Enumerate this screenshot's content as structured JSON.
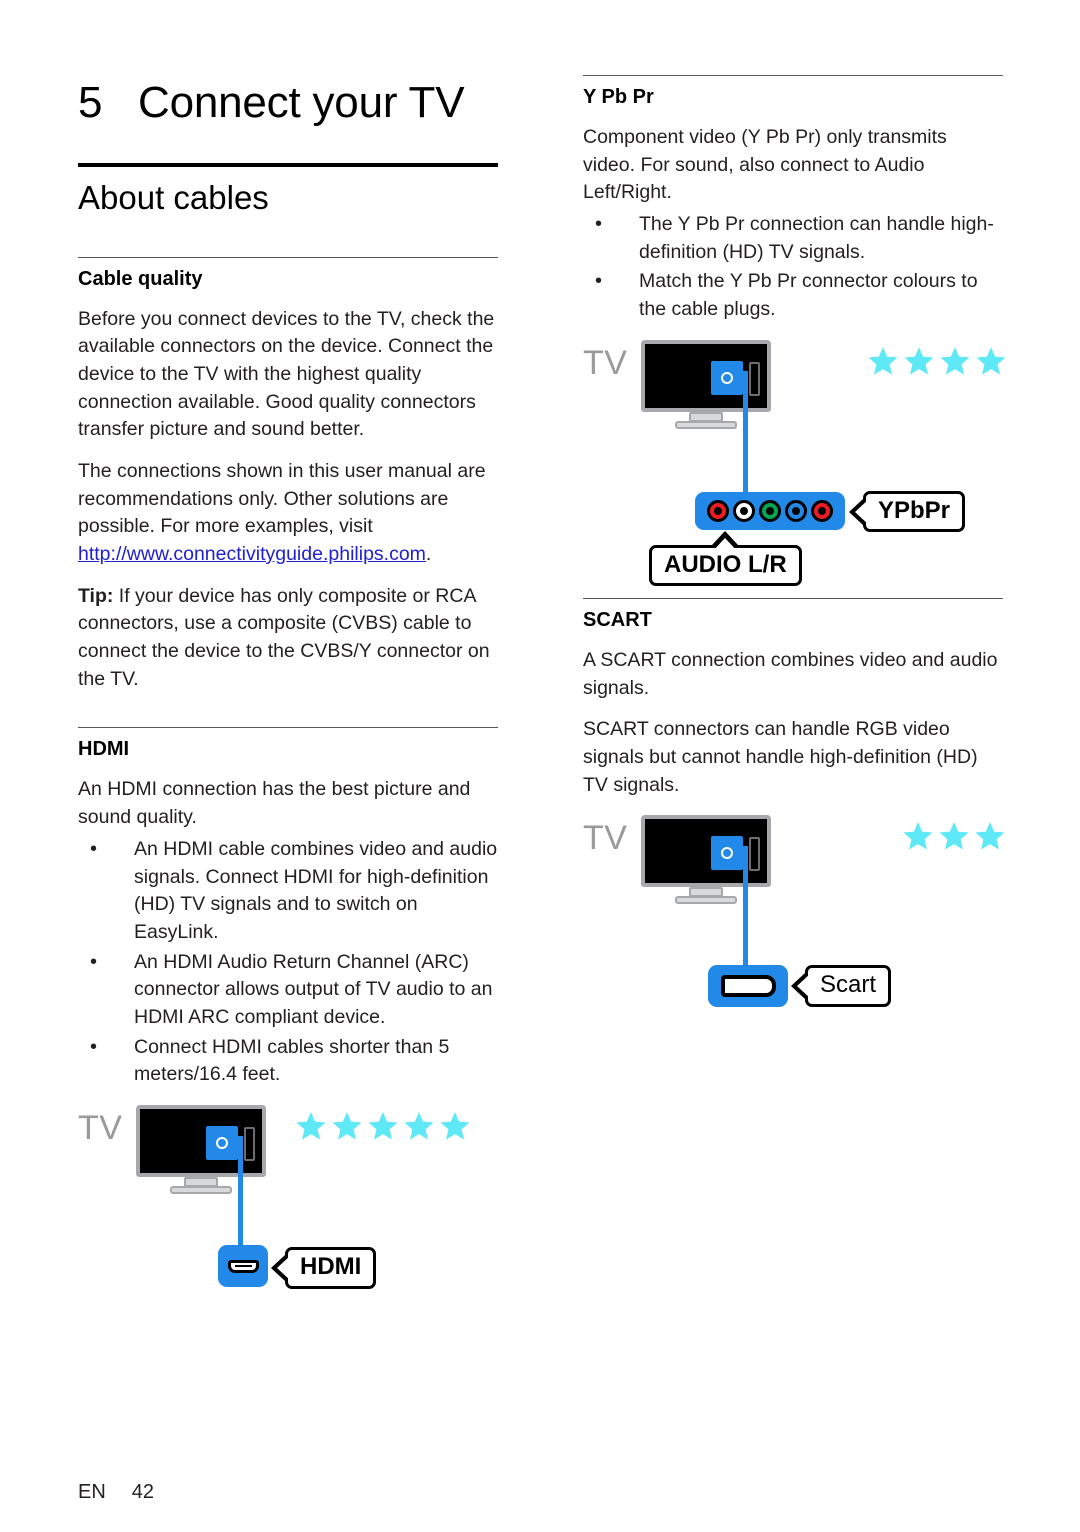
{
  "document": {
    "chapter_number": "5",
    "chapter_title": "Connect your TV",
    "footer": {
      "language": "EN",
      "page_number": "42"
    }
  },
  "left_column": {
    "section_heading": "About cables",
    "cable_quality": {
      "heading": "Cable quality",
      "paragraph_1": "Before you connect devices to the TV, check the available connectors on the device. Connect the device to the TV with the highest quality connection available. Good quality connectors transfer picture and sound better.",
      "paragraph_2_before_link": "The connections shown in this user manual are recommendations only. Other solutions are possible. For more examples, visit ",
      "link_text": "http://www.connectivityguide.philips.com",
      "paragraph_2_after_link": ".",
      "tip_label": "Tip:",
      "tip_text": " If your device has only composite or RCA connectors, use a composite (CVBS) cable to connect the device to the CVBS/Y connector on the TV."
    },
    "hdmi": {
      "heading": "HDMI",
      "intro": "An HDMI connection has the best picture and sound quality.",
      "bullets": [
        "An HDMI cable combines video and audio signals. Connect HDMI for high-definition (HD) TV signals and to switch on EasyLink.",
        "An HDMI Audio Return Channel (ARC) connector allows output of TV audio to an HDMI ARC compliant device.",
        "Connect HDMI cables shorter than 5 meters/16.4 feet."
      ],
      "figure": {
        "tv_label": "TV",
        "connector_label": "HDMI",
        "star_rating": 5
      }
    }
  },
  "right_column": {
    "ypbpr": {
      "heading": "Y Pb Pr",
      "intro": "Component video (Y Pb Pr) only transmits video. For sound, also connect to Audio Left/Right.",
      "bullets": [
        "The Y Pb Pr connection can handle high-definition (HD) TV signals.",
        "Match the Y Pb Pr connector colours to the cable plugs."
      ],
      "figure": {
        "tv_label": "TV",
        "connector_label": "YPbPr",
        "audio_label": "AUDIO L/R",
        "star_rating": 4,
        "rca_colours": [
          "#ed1c24",
          "#ffffff",
          "#00a651",
          "#2389e8",
          "#ed1c24"
        ]
      }
    },
    "scart": {
      "heading": "SCART",
      "paragraph_1": "A SCART connection combines video and audio signals.",
      "paragraph_2": "SCART connectors can handle RGB video signals but cannot handle high-definition (HD) TV signals.",
      "figure": {
        "tv_label": "TV",
        "connector_label": "Scart",
        "star_rating": 3
      }
    }
  },
  "colors": {
    "accent_blue": "#2389e8",
    "star_cyan": "#5fe8f5",
    "link_blue": "#2020d0",
    "tv_label_gray": "#9a9a9a",
    "text": "#231f20"
  }
}
